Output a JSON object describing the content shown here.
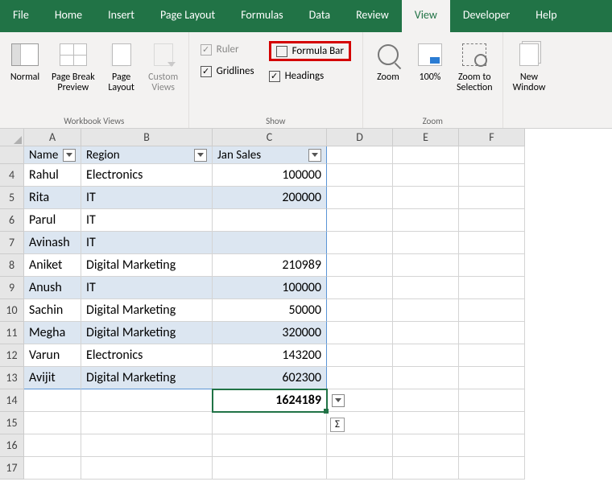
{
  "tabs": [
    "File",
    "Home",
    "Insert",
    "Page Layout",
    "Formulas",
    "Data",
    "Review",
    "View",
    "Developer",
    "Help"
  ],
  "active_tab": "View",
  "ribbon": {
    "workbook_views": {
      "label": "Workbook Views",
      "normal": "Normal",
      "page_break": "Page Break\nPreview",
      "page_layout": "Page\nLayout",
      "custom_views": "Custom\nViews"
    },
    "show": {
      "label": "Show",
      "ruler": "Ruler",
      "formula_bar": "Formula Bar",
      "gridlines": "Gridlines",
      "headings": "Headings"
    },
    "zoom": {
      "label": "Zoom",
      "zoom_btn": "Zoom",
      "hundred": "100%",
      "zoom_to_selection": "Zoom to\nSelection"
    },
    "window": {
      "new_window": "New\nWindow"
    }
  },
  "columns": {
    "A": 71,
    "B": 163,
    "C": 142,
    "D": 82,
    "E": 82,
    "F": 82
  },
  "row_start": 4,
  "row_count": 14,
  "table": {
    "headers": {
      "A": "Name",
      "B": "Region",
      "C": "Jan Sales"
    },
    "rows": [
      {
        "A": "Rahul",
        "B": "Electronics",
        "C": "100000"
      },
      {
        "A": "Rita",
        "B": "IT",
        "C": "200000"
      },
      {
        "A": "Parul",
        "B": "IT",
        "C": ""
      },
      {
        "A": "Avinash",
        "B": "IT",
        "C": ""
      },
      {
        "A": "Aniket",
        "B": "Digital Marketing",
        "C": "210989"
      },
      {
        "A": "Anush",
        "B": "IT",
        "C": "100000"
      },
      {
        "A": "Sachin",
        "B": "Digital Marketing",
        "C": "50000"
      },
      {
        "A": "Megha",
        "B": "Digital Marketing",
        "C": "320000"
      },
      {
        "A": "Varun",
        "B": "Electronics",
        "C": "143200"
      },
      {
        "A": "Avijit",
        "B": "Digital Marketing",
        "C": "602300"
      }
    ],
    "total_c": "1624189"
  },
  "checkbox_states": {
    "ruler": true,
    "formula_bar": false,
    "gridlines": true,
    "headings": true
  }
}
